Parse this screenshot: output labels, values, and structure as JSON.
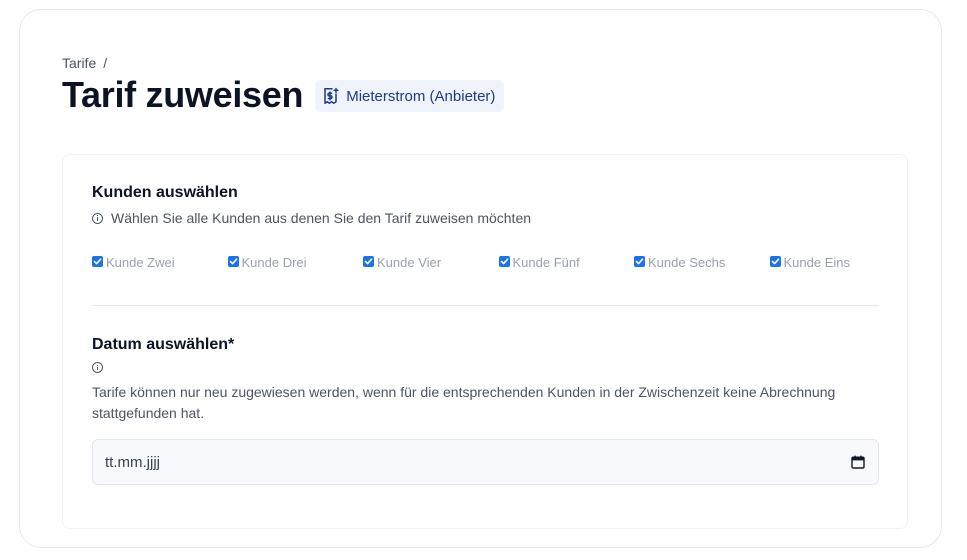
{
  "breadcrumb": {
    "root": "Tarife",
    "separator": "/"
  },
  "page": {
    "title": "Tarif zuweisen"
  },
  "tariff_badge": {
    "icon": "receipt-dollar-icon",
    "label": "Mieterstrom (Anbieter)"
  },
  "customers_section": {
    "title": "Kunden auswählen",
    "hint_icon": "info-icon",
    "hint": "Wählen Sie alle Kunden aus denen Sie den Tarif zuweisen möchten",
    "customers": [
      {
        "label": "Kunde Zwei",
        "checked": true
      },
      {
        "label": "Kunde Drei",
        "checked": true
      },
      {
        "label": "Kunde Vier",
        "checked": true
      },
      {
        "label": "Kunde Fünf",
        "checked": true
      },
      {
        "label": "Kunde Sechs",
        "checked": true
      },
      {
        "label": "Kunde Eins",
        "checked": true
      }
    ]
  },
  "date_section": {
    "title": "Datum auswählen*",
    "hint_icon": "info-icon",
    "description": "Tarife können nur neu zugewiesen werden, wenn für die entsprechenden Kunden in der Zwischenzeit keine Abrechnung stattgefunden hat.",
    "input_placeholder": "tt.mm.jjjj",
    "input_icon": "calendar-icon"
  },
  "colors": {
    "accent": "#1a73e8",
    "badge_bg": "#eff3fb",
    "badge_text": "#1e3a8a",
    "heading": "#0b1324",
    "muted_text": "#4b5563",
    "checkbox_label": "#9aa0ab"
  }
}
